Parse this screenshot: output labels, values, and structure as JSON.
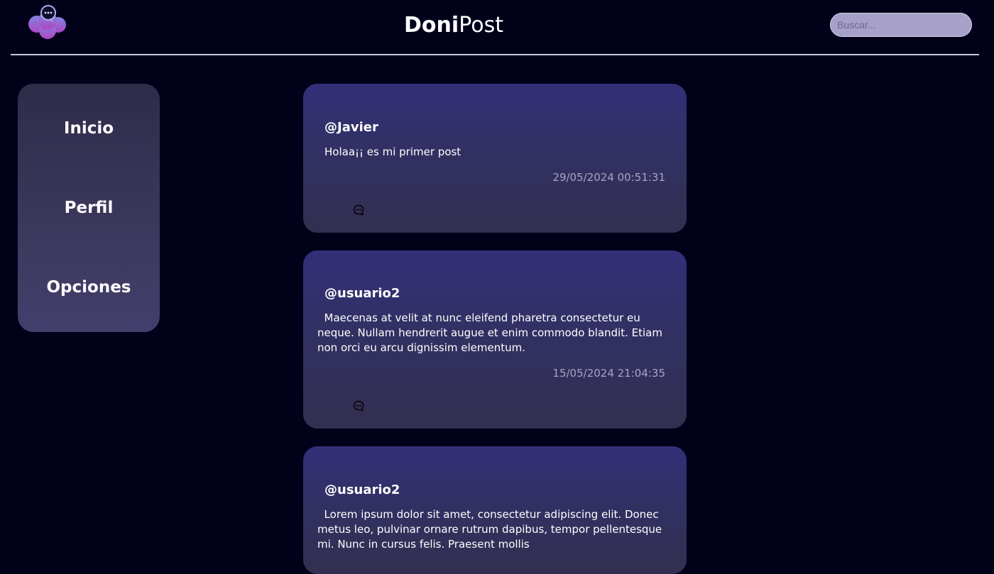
{
  "header": {
    "brand_bold": "Doni",
    "brand_regular": "Post",
    "search_placeholder": "Buscar..."
  },
  "sidebar": {
    "items": [
      {
        "label": "Inicio"
      },
      {
        "label": "Perfil"
      },
      {
        "label": "Opciones"
      }
    ]
  },
  "posts": [
    {
      "user": "@Javier",
      "content": "Holaa¡¡ es mi primer post",
      "date": "29/05/2024 00:51:31",
      "comment_icon": "chat-bubble-icon"
    },
    {
      "user": "@usuario2",
      "content": "  Maecenas at velit at nunc eleifend pharetra consectetur eu neque. Nullam hendrerit augue et enim commodo blandit. Etiam non orci eu arcu dignissim elementum.",
      "date": "15/05/2024 21:04:35",
      "comment_icon": "chat-bubble-icon"
    },
    {
      "user": "@usuario2",
      "content": "  Lorem ipsum dolor sit amet, consectetur adipiscing elit. Donec metus leo, pulvinar ornare rutrum dapibus, tempor pellentesque mi. Nunc in cursus felis. Praesent mollis",
      "date": "",
      "comment_icon": "chat-bubble-icon"
    }
  ],
  "colors": {
    "background": "#02011a",
    "card_top": "#332f78",
    "card_bottom": "#332f50",
    "sidebar": "#3c385d"
  }
}
